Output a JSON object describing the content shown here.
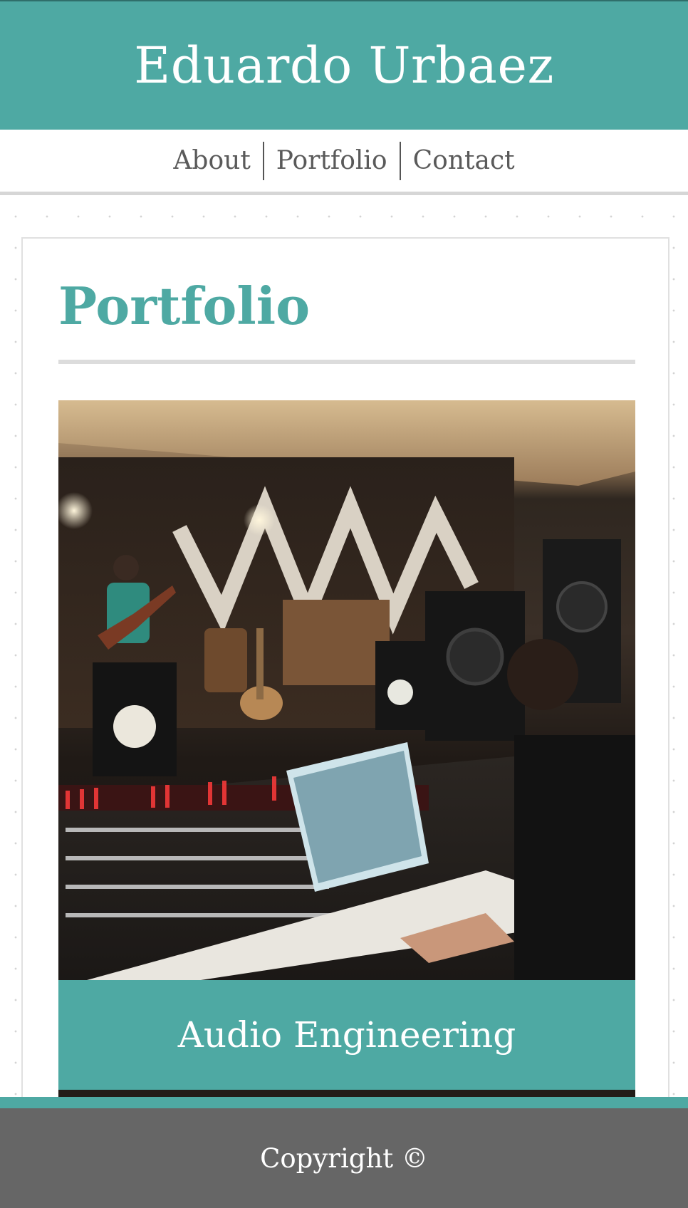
{
  "header": {
    "site_title": "Eduardo Urbaez"
  },
  "nav": {
    "items": [
      {
        "label": "About"
      },
      {
        "label": "Portfolio"
      },
      {
        "label": "Contact"
      }
    ]
  },
  "main": {
    "page_title": "Portfolio",
    "portfolio_items": [
      {
        "caption": "Audio Engineering",
        "image_subject": "recording studio with mixing console, monitor speakers and a guitarist in the live room"
      }
    ]
  },
  "footer": {
    "copyright": "Copyright ©"
  },
  "colors": {
    "accent": "#4ea9a3",
    "footer_bg": "#666666",
    "nav_text": "#5a5a5a",
    "rule": "#dcdcdc"
  }
}
